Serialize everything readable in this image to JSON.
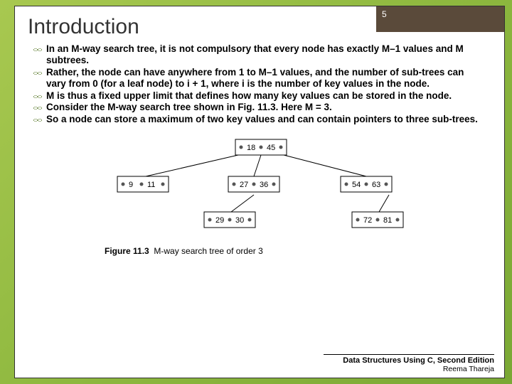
{
  "page_number": "5",
  "title": "Introduction",
  "bullets": [
    "In an M-way search tree, it is not compulsory that every node has exactly M–1 values and M subtrees.",
    "Rather, the node can have anywhere from 1 to M–1 values, and the number of sub-trees can vary from 0 (for a leaf node) to i + 1, where i is the number of key values in the node.",
    "M is thus a fixed upper limit that defines how many key values can be stored in the node.",
    "Consider the M-way search tree shown in Fig. 11.3. Here M = 3.",
    "So a node can store a maximum of two key values and can contain pointers to three sub-trees."
  ],
  "figure": {
    "label": "Figure 11.3",
    "caption": "M-way search tree of order 3",
    "root": [
      "18",
      "45"
    ],
    "level2": [
      [
        "9",
        "11"
      ],
      [
        "27",
        "36"
      ],
      [
        "54",
        "63"
      ]
    ],
    "level3": [
      [
        "29",
        "30"
      ],
      [
        "72",
        "81"
      ]
    ]
  },
  "footer": {
    "line1": "Data Structures Using C, Second Edition",
    "line2": "Reema Thareja"
  }
}
